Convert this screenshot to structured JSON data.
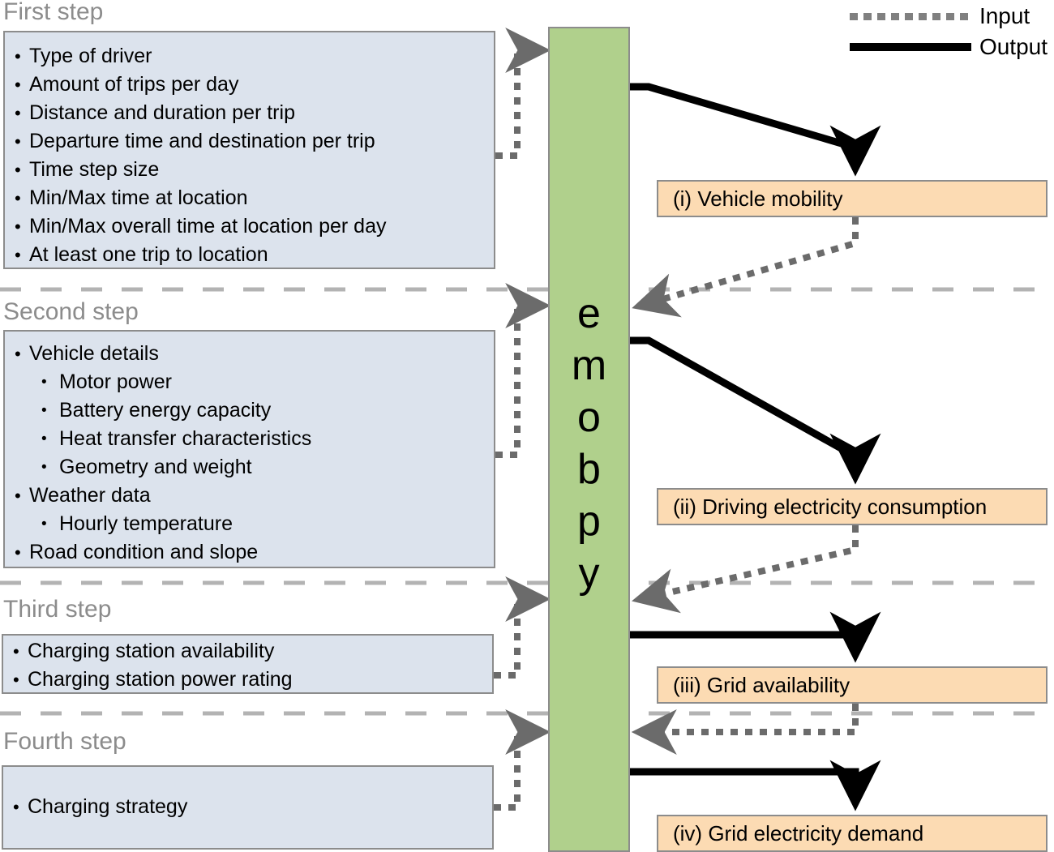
{
  "legend": {
    "input_label": "Input",
    "output_label": "Output",
    "input_color": "#808080",
    "output_color": "#000000"
  },
  "engine": {
    "name": "emobpy",
    "letters": [
      "e",
      "m",
      "o",
      "b",
      "p",
      "y"
    ],
    "fill_color": "#b0d08c",
    "border_color": "#8c8c8c"
  },
  "colors": {
    "input_box_fill": "#dce3ed",
    "output_box_fill": "#fcdbb3",
    "box_border": "#8c8c8c",
    "separator": "#b3b3b3",
    "title_text": "#8c8c8c"
  },
  "steps": [
    {
      "title": "First step",
      "items": [
        {
          "level": 1,
          "text": "Type of driver"
        },
        {
          "level": 1,
          "text": "Amount of trips per day"
        },
        {
          "level": 1,
          "text": "Distance and duration per trip"
        },
        {
          "level": 1,
          "text": "Departure time and destination per trip"
        },
        {
          "level": 1,
          "text": "Time step size"
        },
        {
          "level": 1,
          "text": "Min/Max time at location"
        },
        {
          "level": 1,
          "text": "Min/Max overall time at location per day"
        },
        {
          "level": 1,
          "text": "At least one trip to location"
        }
      ]
    },
    {
      "title": "Second step",
      "items": [
        {
          "level": 1,
          "text": "Vehicle details"
        },
        {
          "level": 2,
          "text": "Motor power"
        },
        {
          "level": 2,
          "text": "Battery energy capacity"
        },
        {
          "level": 2,
          "text": "Heat transfer characteristics"
        },
        {
          "level": 2,
          "text": "Geometry and weight"
        },
        {
          "level": 1,
          "text": "Weather data"
        },
        {
          "level": 2,
          "text": "Hourly temperature"
        },
        {
          "level": 1,
          "text": "Road condition and slope"
        }
      ]
    },
    {
      "title": "Third step",
      "items": [
        {
          "level": 1,
          "text": "Charging station availability"
        },
        {
          "level": 1,
          "text": "Charging station power rating"
        }
      ]
    },
    {
      "title": "Fourth step",
      "items": [
        {
          "level": 1,
          "text": "Charging strategy"
        }
      ]
    }
  ],
  "outputs": [
    {
      "label": "(i) Vehicle mobility"
    },
    {
      "label": "(ii) Driving electricity consumption"
    },
    {
      "label": "(iii) Grid availability"
    },
    {
      "label": "(iv) Grid electricity demand"
    }
  ]
}
